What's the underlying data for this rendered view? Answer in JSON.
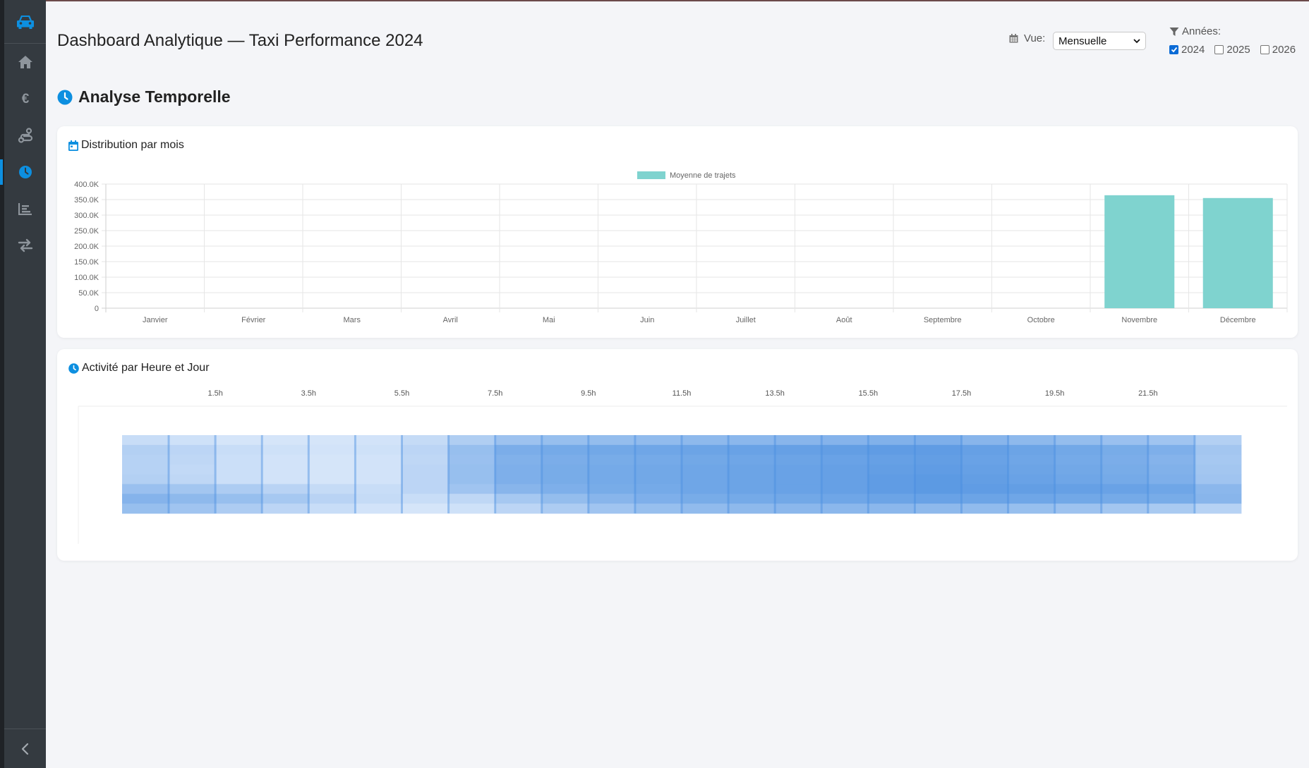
{
  "app": {
    "page_title": "Dashboard Analytique — Taxi Performance 2024"
  },
  "sidebar": {
    "logo_icon": "taxi-icon",
    "items": [
      {
        "icon": "home-icon",
        "active": false
      },
      {
        "icon": "euro-icon",
        "active": false
      },
      {
        "icon": "route-icon",
        "active": false
      },
      {
        "icon": "clock-icon",
        "active": true
      },
      {
        "icon": "chart-icon",
        "active": false
      },
      {
        "icon": "exchange-icon",
        "active": false
      }
    ],
    "collapse_icon": "chevron-left-icon"
  },
  "controls": {
    "vue_label": "Vue:",
    "vue_selected": "Mensuelle",
    "years_label": "Années:",
    "years": [
      {
        "label": "2024",
        "checked": true
      },
      {
        "label": "2025",
        "checked": false
      },
      {
        "label": "2026",
        "checked": false
      }
    ]
  },
  "section": {
    "title": "Analyse Temporelle"
  },
  "cards": {
    "monthly_title": "Distribution par mois",
    "heatmap_title": "Activité par Heure et Jour"
  },
  "colors": {
    "accent": "#0d8fe0",
    "bar": "#7fd3cf",
    "heat_base": "#4a8fe0"
  },
  "chart_data": [
    {
      "type": "bar",
      "title": "",
      "legend": [
        "Moyenne de trajets"
      ],
      "categories": [
        "Janvier",
        "Février",
        "Mars",
        "Avril",
        "Mai",
        "Juin",
        "Juillet",
        "Août",
        "Septembre",
        "Octobre",
        "Novembre",
        "Décembre"
      ],
      "series": [
        {
          "name": "Moyenne de trajets",
          "values": [
            0,
            0,
            0,
            0,
            0,
            0,
            0,
            0,
            0,
            0,
            364000,
            355000
          ]
        }
      ],
      "y_ticks": [
        "0",
        "50.0K",
        "100.0K",
        "150.0K",
        "200.0K",
        "250.0K",
        "300.0K",
        "350.0K",
        "400.0K"
      ],
      "ylim": [
        0,
        400000
      ],
      "legend_position": "top",
      "grid": true
    },
    {
      "type": "heatmap",
      "title": "",
      "x_tick_labels": [
        "1.5h",
        "3.5h",
        "5.5h",
        "7.5h",
        "9.5h",
        "11.5h",
        "13.5h",
        "15.5h",
        "17.5h",
        "19.5h",
        "21.5h"
      ],
      "columns": 24,
      "rows": 8,
      "intensity": [
        [
          0.18,
          0.14,
          0.1,
          0.1,
          0.1,
          0.12,
          0.2,
          0.34,
          0.46,
          0.5,
          0.52,
          0.54,
          0.56,
          0.58,
          0.6,
          0.62,
          0.64,
          0.66,
          0.6,
          0.56,
          0.52,
          0.48,
          0.44,
          0.32
        ],
        [
          0.32,
          0.26,
          0.18,
          0.14,
          0.12,
          0.14,
          0.26,
          0.5,
          0.68,
          0.72,
          0.74,
          0.76,
          0.78,
          0.8,
          0.82,
          0.84,
          0.86,
          0.86,
          0.82,
          0.78,
          0.74,
          0.7,
          0.66,
          0.42
        ],
        [
          0.3,
          0.24,
          0.16,
          0.12,
          0.1,
          0.12,
          0.24,
          0.48,
          0.64,
          0.68,
          0.7,
          0.72,
          0.74,
          0.76,
          0.78,
          0.8,
          0.82,
          0.84,
          0.8,
          0.76,
          0.72,
          0.68,
          0.62,
          0.4
        ],
        [
          0.3,
          0.22,
          0.16,
          0.12,
          0.1,
          0.12,
          0.26,
          0.5,
          0.66,
          0.7,
          0.72,
          0.74,
          0.76,
          0.78,
          0.8,
          0.82,
          0.84,
          0.86,
          0.82,
          0.78,
          0.74,
          0.7,
          0.64,
          0.42
        ],
        [
          0.32,
          0.24,
          0.16,
          0.12,
          0.1,
          0.12,
          0.26,
          0.5,
          0.66,
          0.7,
          0.72,
          0.74,
          0.76,
          0.78,
          0.8,
          0.82,
          0.86,
          0.88,
          0.84,
          0.8,
          0.76,
          0.72,
          0.66,
          0.44
        ],
        [
          0.48,
          0.42,
          0.36,
          0.28,
          0.2,
          0.18,
          0.26,
          0.44,
          0.6,
          0.66,
          0.7,
          0.72,
          0.76,
          0.78,
          0.8,
          0.82,
          0.86,
          0.88,
          0.86,
          0.84,
          0.82,
          0.8,
          0.76,
          0.58
        ],
        [
          0.62,
          0.56,
          0.5,
          0.4,
          0.28,
          0.2,
          0.18,
          0.24,
          0.4,
          0.52,
          0.6,
          0.66,
          0.7,
          0.72,
          0.74,
          0.76,
          0.78,
          0.8,
          0.78,
          0.76,
          0.74,
          0.72,
          0.7,
          0.6
        ],
        [
          0.5,
          0.44,
          0.36,
          0.26,
          0.18,
          0.12,
          0.1,
          0.14,
          0.26,
          0.36,
          0.44,
          0.5,
          0.54,
          0.56,
          0.58,
          0.58,
          0.58,
          0.56,
          0.54,
          0.5,
          0.46,
          0.42,
          0.38,
          0.3
        ]
      ],
      "legend_position": "none"
    }
  ]
}
